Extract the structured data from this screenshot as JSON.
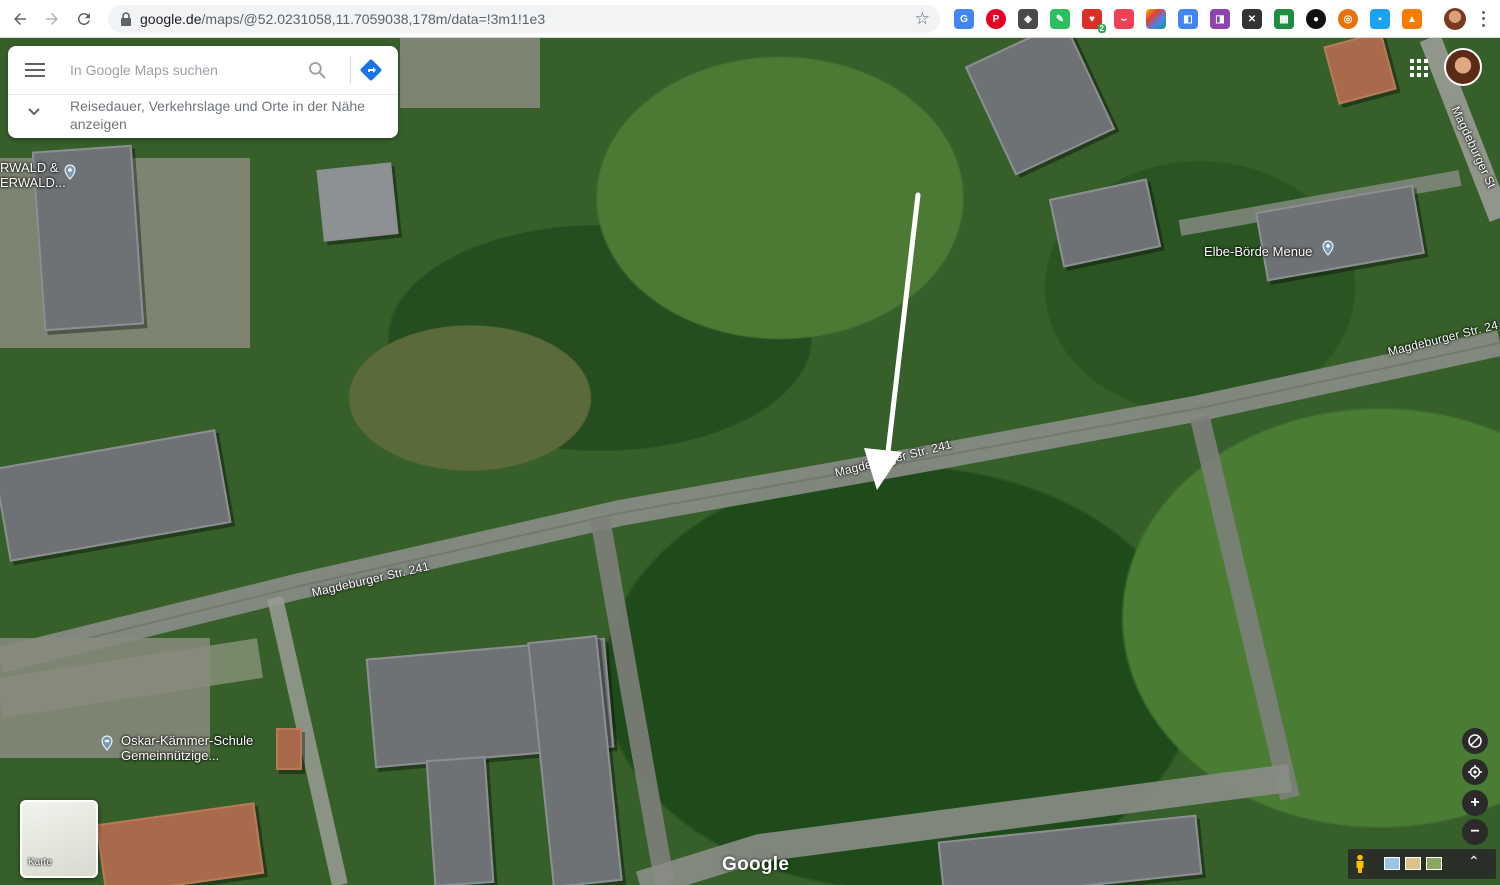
{
  "browser": {
    "url_host": "google.de",
    "url_path": "/maps/@52.0231058,11.7059038,178m/data=!3m1!1e3",
    "extension_badge": "2"
  },
  "search": {
    "placeholder": "In Google Maps suchen",
    "nearby_text": "Reisedauer, Verkehrslage und Orte in der Nähe anzeigen"
  },
  "map": {
    "street_labels": {
      "main_left": "Magdeburger Str. 241",
      "main_center": "Magdeburger Str. 241",
      "right": "Magdeburger Str. 24",
      "vertical_right": "Magdeburger St"
    },
    "places": {
      "top_left_line1": "RWALD &",
      "top_left_line2": "ERWALD...",
      "elbe": "Elbe-Börde Menue",
      "school_line1": "Oskar-Kämmer-Schule",
      "school_line2": "Gemeinnützige..."
    },
    "layer_label": "Karte",
    "attribution": "Google"
  },
  "colors": {
    "accent_blue": "#1a73e8",
    "pin_gray": "#7b9cb6"
  }
}
